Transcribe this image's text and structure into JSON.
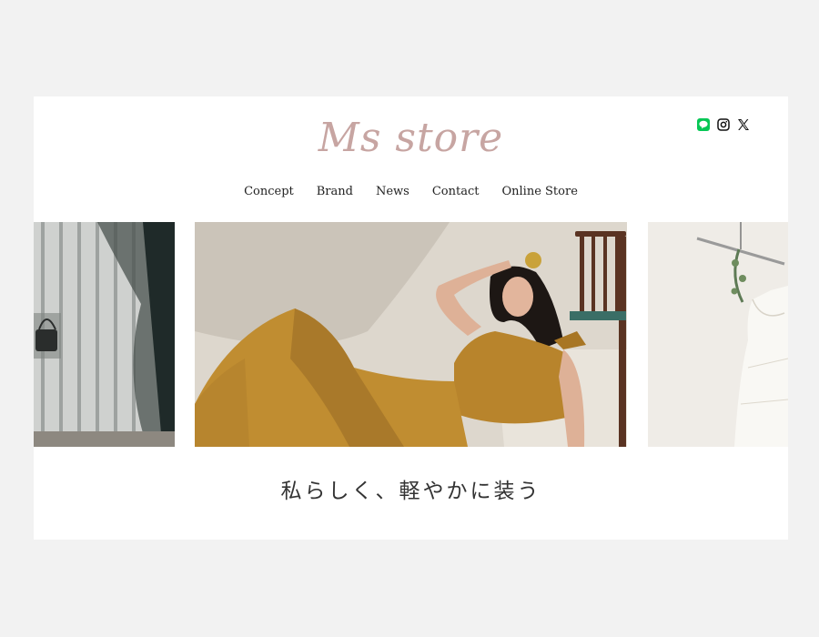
{
  "brand": {
    "logo_text": "Ms store",
    "logo_color": "#c7a5a2"
  },
  "social": [
    {
      "name": "line",
      "icon": "line-icon",
      "color": "#06c755"
    },
    {
      "name": "instagram",
      "icon": "instagram-icon",
      "color": "#111111"
    },
    {
      "name": "x",
      "icon": "x-icon",
      "color": "#111111"
    }
  ],
  "nav": {
    "items": [
      "Concept",
      "Brand",
      "News",
      "Contact",
      "Online Store"
    ]
  },
  "slider": {
    "slides": [
      {
        "name": "slide-wall-bag"
      },
      {
        "name": "slide-woman-mustard-outfit"
      },
      {
        "name": "slide-white-dress-hanger"
      }
    ]
  },
  "hero": {
    "tagline": "私らしく、軽やかに装う"
  }
}
